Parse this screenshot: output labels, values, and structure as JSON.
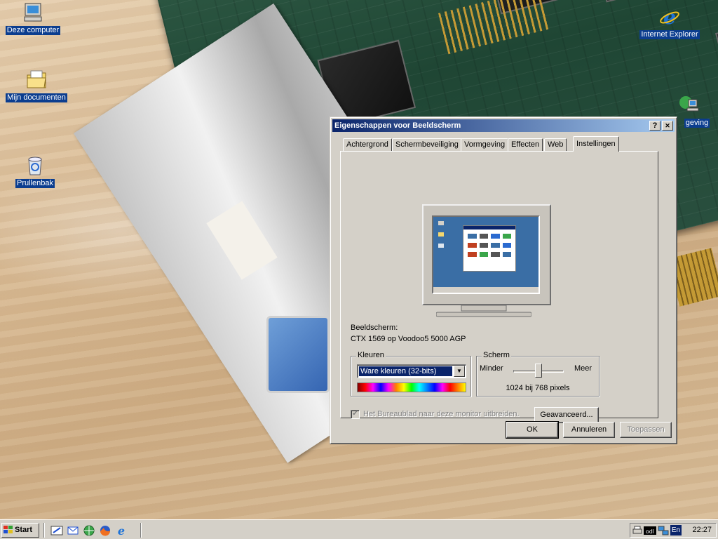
{
  "desktop": {
    "icons": [
      {
        "label": "Deze computer",
        "icon": "my-computer-icon"
      },
      {
        "label": "Mijn documenten",
        "icon": "folder-icon"
      },
      {
        "label": "Prullenbak",
        "icon": "recycle-bin-icon"
      },
      {
        "label": "Internet Explorer",
        "icon": "internet-explorer-icon"
      },
      {
        "label": "geving",
        "icon": "network-neighborhood-icon"
      }
    ]
  },
  "dialog": {
    "title": "Eigenschappen voor Beeldscherm",
    "help_btn": "?",
    "close_btn": "✕",
    "tabs": [
      {
        "label": "Achtergrond",
        "active": false
      },
      {
        "label": "Schermbeveiliging",
        "active": false
      },
      {
        "label": "Vormgeving",
        "active": false
      },
      {
        "label": "Effecten",
        "active": false
      },
      {
        "label": "Web",
        "active": false
      },
      {
        "label": "Instellingen",
        "active": true
      }
    ],
    "display_label": "Beeldscherm:",
    "display_value": "CTX 1569 op Voodoo5 5000 AGP",
    "colors": {
      "group_title": "Kleuren",
      "selected": "Ware kleuren (32-bits)"
    },
    "screen": {
      "group_title": "Scherm",
      "min_label": "Minder",
      "max_label": "Meer",
      "slider_level": 0.5,
      "resolution": "1024 bij 768 pixels"
    },
    "extend_checkbox": {
      "label": "Het Bureaublad naar deze monitor uitbreiden.",
      "checked": true,
      "enabled": false
    },
    "advanced_btn": "Geavanceerd...",
    "ok_btn": "OK",
    "cancel_btn": "Annuleren",
    "apply_btn": "Toepassen"
  },
  "taskbar": {
    "start_label": "Start",
    "quick_launch": [
      "show-desktop-icon",
      "outlook-express-icon",
      "network-icon",
      "firefox-icon",
      "internet-explorer-icon"
    ],
    "tray_icons": [
      "printer-icon",
      "odl-icon",
      "network-tray-icon"
    ],
    "language": "En",
    "clock": "22:27"
  },
  "colors": {
    "titlebar_start": "#0a246a",
    "titlebar_end": "#a6caf0",
    "window_face": "#d4d0c8",
    "desktop_label_bg": "#0b3d8f"
  }
}
